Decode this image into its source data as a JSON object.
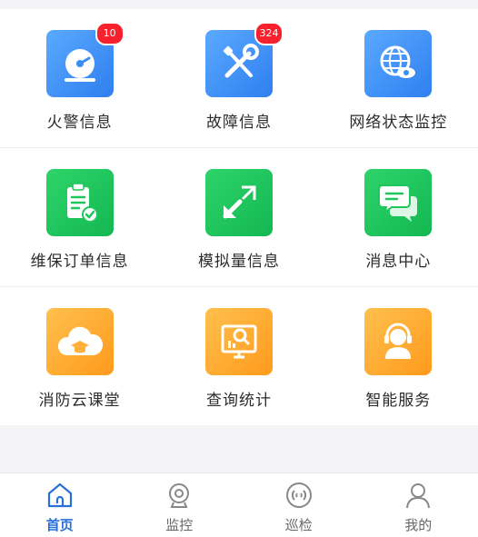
{
  "grid": {
    "items": [
      {
        "label": "火警信息",
        "icon": "alarm-bell-icon",
        "badge": "10",
        "color": "#3b8cf5"
      },
      {
        "label": "故障信息",
        "icon": "wrench-screwdriver-icon",
        "badge": "324",
        "color": "#3b8cf5"
      },
      {
        "label": "网络状态监控",
        "icon": "globe-eye-icon",
        "badge": null,
        "color": "#3b8cf5"
      },
      {
        "label": "维保订单信息",
        "icon": "clipboard-check-icon",
        "badge": null,
        "color": "#1ec65c"
      },
      {
        "label": "模拟量信息",
        "icon": "resize-arrows-icon",
        "badge": null,
        "color": "#1ec65c"
      },
      {
        "label": "消息中心",
        "icon": "chat-bubbles-icon",
        "badge": null,
        "color": "#1ec65c"
      },
      {
        "label": "消防云课堂",
        "icon": "cloud-graduation-icon",
        "badge": null,
        "color": "#ffa726"
      },
      {
        "label": "查询统计",
        "icon": "search-chart-icon",
        "badge": null,
        "color": "#ffa726"
      },
      {
        "label": "智能服务",
        "icon": "headset-agent-icon",
        "badge": null,
        "color": "#ffa726"
      }
    ]
  },
  "tabbar": {
    "tabs": [
      {
        "label": "首页",
        "icon": "home-icon",
        "active": true
      },
      {
        "label": "监控",
        "icon": "webcam-icon",
        "active": false
      },
      {
        "label": "巡检",
        "icon": "signal-icon",
        "active": false
      },
      {
        "label": "我的",
        "icon": "user-icon",
        "active": false
      }
    ],
    "active_color": "#2b6fd8",
    "inactive_color": "#666666"
  }
}
